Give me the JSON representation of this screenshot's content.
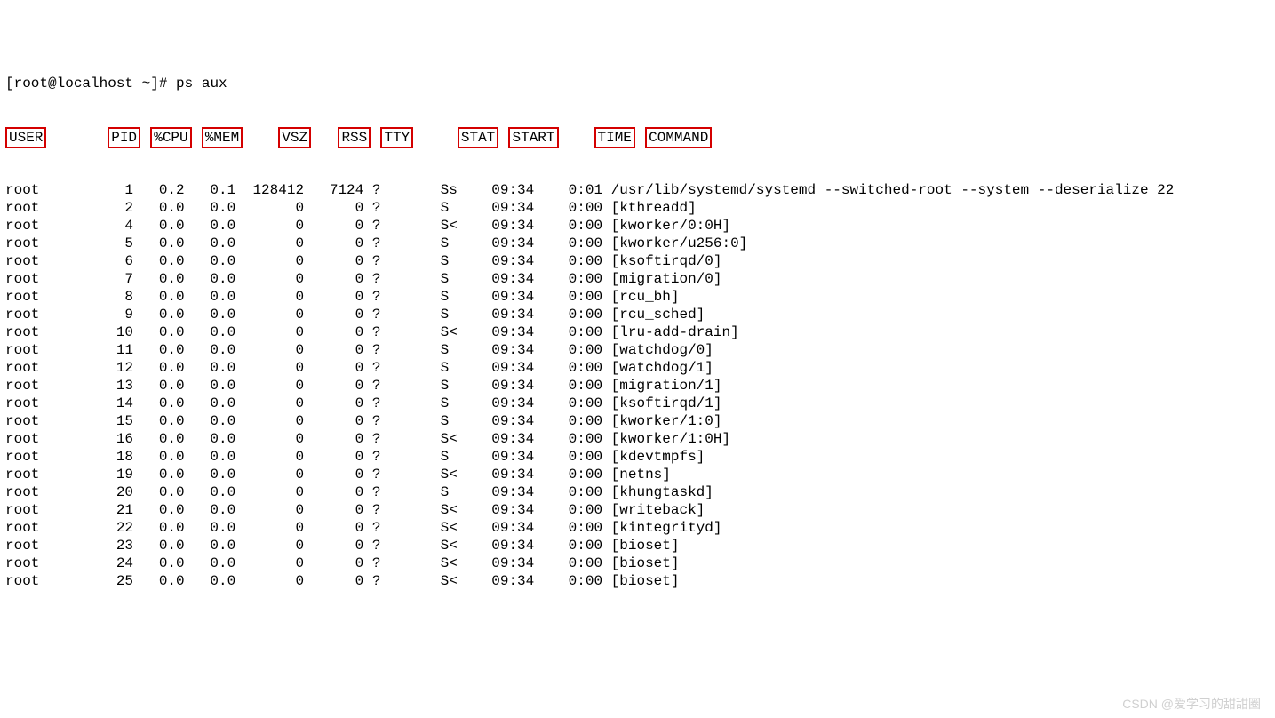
{
  "prompt": "[root@localhost ~]# ps aux",
  "headers": [
    "USER",
    "PID",
    "%CPU",
    "%MEM",
    "VSZ",
    "RSS",
    "TTY",
    "STAT",
    "START",
    "TIME",
    "COMMAND"
  ],
  "watermark": "CSDN @爱学习的甜甜圈",
  "rows": [
    {
      "user": "root",
      "pid": "1",
      "cpu": "0.2",
      "mem": "0.1",
      "vsz": "128412",
      "rss": "7124",
      "tty": "?",
      "stat": "Ss",
      "start": "09:34",
      "time": "0:01",
      "cmd": "/usr/lib/systemd/systemd --switched-root --system --deserialize 22"
    },
    {
      "user": "root",
      "pid": "2",
      "cpu": "0.0",
      "mem": "0.0",
      "vsz": "0",
      "rss": "0",
      "tty": "?",
      "stat": "S",
      "start": "09:34",
      "time": "0:00",
      "cmd": "[kthreadd]"
    },
    {
      "user": "root",
      "pid": "4",
      "cpu": "0.0",
      "mem": "0.0",
      "vsz": "0",
      "rss": "0",
      "tty": "?",
      "stat": "S<",
      "start": "09:34",
      "time": "0:00",
      "cmd": "[kworker/0:0H]"
    },
    {
      "user": "root",
      "pid": "5",
      "cpu": "0.0",
      "mem": "0.0",
      "vsz": "0",
      "rss": "0",
      "tty": "?",
      "stat": "S",
      "start": "09:34",
      "time": "0:00",
      "cmd": "[kworker/u256:0]"
    },
    {
      "user": "root",
      "pid": "6",
      "cpu": "0.0",
      "mem": "0.0",
      "vsz": "0",
      "rss": "0",
      "tty": "?",
      "stat": "S",
      "start": "09:34",
      "time": "0:00",
      "cmd": "[ksoftirqd/0]"
    },
    {
      "user": "root",
      "pid": "7",
      "cpu": "0.0",
      "mem": "0.0",
      "vsz": "0",
      "rss": "0",
      "tty": "?",
      "stat": "S",
      "start": "09:34",
      "time": "0:00",
      "cmd": "[migration/0]"
    },
    {
      "user": "root",
      "pid": "8",
      "cpu": "0.0",
      "mem": "0.0",
      "vsz": "0",
      "rss": "0",
      "tty": "?",
      "stat": "S",
      "start": "09:34",
      "time": "0:00",
      "cmd": "[rcu_bh]"
    },
    {
      "user": "root",
      "pid": "9",
      "cpu": "0.0",
      "mem": "0.0",
      "vsz": "0",
      "rss": "0",
      "tty": "?",
      "stat": "S",
      "start": "09:34",
      "time": "0:00",
      "cmd": "[rcu_sched]"
    },
    {
      "user": "root",
      "pid": "10",
      "cpu": "0.0",
      "mem": "0.0",
      "vsz": "0",
      "rss": "0",
      "tty": "?",
      "stat": "S<",
      "start": "09:34",
      "time": "0:00",
      "cmd": "[lru-add-drain]"
    },
    {
      "user": "root",
      "pid": "11",
      "cpu": "0.0",
      "mem": "0.0",
      "vsz": "0",
      "rss": "0",
      "tty": "?",
      "stat": "S",
      "start": "09:34",
      "time": "0:00",
      "cmd": "[watchdog/0]"
    },
    {
      "user": "root",
      "pid": "12",
      "cpu": "0.0",
      "mem": "0.0",
      "vsz": "0",
      "rss": "0",
      "tty": "?",
      "stat": "S",
      "start": "09:34",
      "time": "0:00",
      "cmd": "[watchdog/1]"
    },
    {
      "user": "root",
      "pid": "13",
      "cpu": "0.0",
      "mem": "0.0",
      "vsz": "0",
      "rss": "0",
      "tty": "?",
      "stat": "S",
      "start": "09:34",
      "time": "0:00",
      "cmd": "[migration/1]"
    },
    {
      "user": "root",
      "pid": "14",
      "cpu": "0.0",
      "mem": "0.0",
      "vsz": "0",
      "rss": "0",
      "tty": "?",
      "stat": "S",
      "start": "09:34",
      "time": "0:00",
      "cmd": "[ksoftirqd/1]"
    },
    {
      "user": "root",
      "pid": "15",
      "cpu": "0.0",
      "mem": "0.0",
      "vsz": "0",
      "rss": "0",
      "tty": "?",
      "stat": "S",
      "start": "09:34",
      "time": "0:00",
      "cmd": "[kworker/1:0]"
    },
    {
      "user": "root",
      "pid": "16",
      "cpu": "0.0",
      "mem": "0.0",
      "vsz": "0",
      "rss": "0",
      "tty": "?",
      "stat": "S<",
      "start": "09:34",
      "time": "0:00",
      "cmd": "[kworker/1:0H]"
    },
    {
      "user": "root",
      "pid": "18",
      "cpu": "0.0",
      "mem": "0.0",
      "vsz": "0",
      "rss": "0",
      "tty": "?",
      "stat": "S",
      "start": "09:34",
      "time": "0:00",
      "cmd": "[kdevtmpfs]"
    },
    {
      "user": "root",
      "pid": "19",
      "cpu": "0.0",
      "mem": "0.0",
      "vsz": "0",
      "rss": "0",
      "tty": "?",
      "stat": "S<",
      "start": "09:34",
      "time": "0:00",
      "cmd": "[netns]"
    },
    {
      "user": "root",
      "pid": "20",
      "cpu": "0.0",
      "mem": "0.0",
      "vsz": "0",
      "rss": "0",
      "tty": "?",
      "stat": "S",
      "start": "09:34",
      "time": "0:00",
      "cmd": "[khungtaskd]"
    },
    {
      "user": "root",
      "pid": "21",
      "cpu": "0.0",
      "mem": "0.0",
      "vsz": "0",
      "rss": "0",
      "tty": "?",
      "stat": "S<",
      "start": "09:34",
      "time": "0:00",
      "cmd": "[writeback]"
    },
    {
      "user": "root",
      "pid": "22",
      "cpu": "0.0",
      "mem": "0.0",
      "vsz": "0",
      "rss": "0",
      "tty": "?",
      "stat": "S<",
      "start": "09:34",
      "time": "0:00",
      "cmd": "[kintegrityd]"
    },
    {
      "user": "root",
      "pid": "23",
      "cpu": "0.0",
      "mem": "0.0",
      "vsz": "0",
      "rss": "0",
      "tty": "?",
      "stat": "S<",
      "start": "09:34",
      "time": "0:00",
      "cmd": "[bioset]"
    },
    {
      "user": "root",
      "pid": "24",
      "cpu": "0.0",
      "mem": "0.0",
      "vsz": "0",
      "rss": "0",
      "tty": "?",
      "stat": "S<",
      "start": "09:34",
      "time": "0:00",
      "cmd": "[bioset]"
    },
    {
      "user": "root",
      "pid": "25",
      "cpu": "0.0",
      "mem": "0.0",
      "vsz": "0",
      "rss": "0",
      "tty": "?",
      "stat": "S<",
      "start": "09:34",
      "time": "0:00",
      "cmd": "[bioset]"
    }
  ]
}
